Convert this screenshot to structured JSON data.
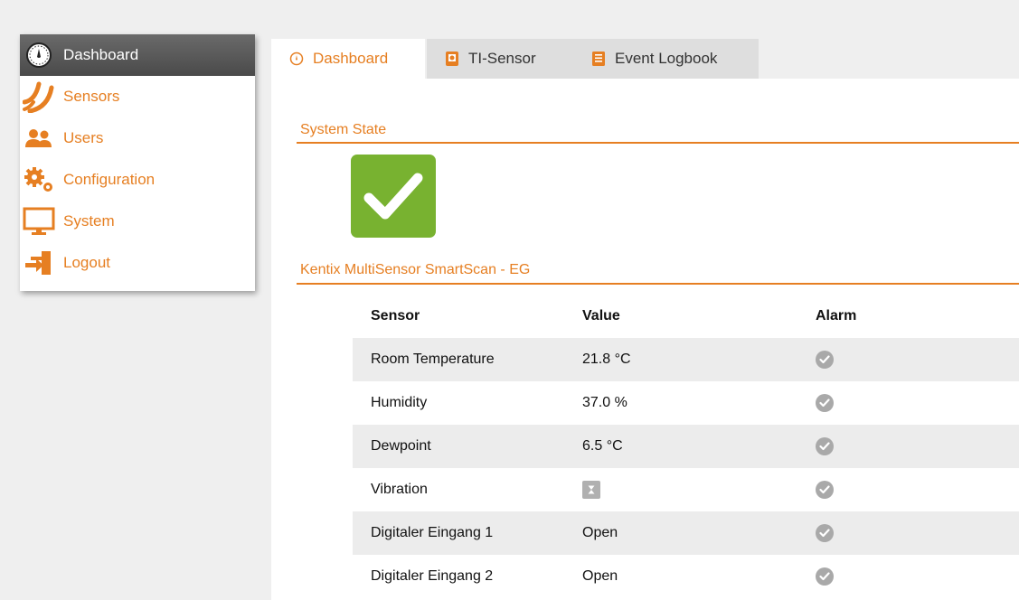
{
  "sidebar": {
    "items": [
      {
        "label": "Dashboard",
        "icon": "gauge-icon",
        "active": true
      },
      {
        "label": "Sensors",
        "icon": "signal-waves-icon",
        "active": false
      },
      {
        "label": "Users",
        "icon": "users-icon",
        "active": false
      },
      {
        "label": "Configuration",
        "icon": "gears-icon",
        "active": false
      },
      {
        "label": "System",
        "icon": "monitor-icon",
        "active": false
      },
      {
        "label": "Logout",
        "icon": "logout-icon",
        "active": false
      }
    ]
  },
  "tabs": [
    {
      "label": "Dashboard",
      "icon": "gauge-icon",
      "active": true
    },
    {
      "label": "TI-Sensor",
      "icon": "device-icon",
      "active": false
    },
    {
      "label": "Event Logbook",
      "icon": "logbook-icon",
      "active": false
    }
  ],
  "system_state": {
    "title": "System State",
    "status_icon": "checkmark-icon",
    "status_color": "#78b230"
  },
  "sensor_table": {
    "title": "Kentix MultiSensor SmartScan - EG",
    "headers": {
      "sensor": "Sensor",
      "value": "Value",
      "alarm": "Alarm"
    },
    "rows": [
      {
        "sensor": "Room Temperature",
        "value": "21.8 °C",
        "alarm_icon": "check-circle-icon"
      },
      {
        "sensor": "Humidity",
        "value": "37.0 %",
        "alarm_icon": "check-circle-icon"
      },
      {
        "sensor": "Dewpoint",
        "value": "6.5 °C",
        "alarm_icon": "check-circle-icon"
      },
      {
        "sensor": "Vibration",
        "value": "",
        "value_icon": "not-available-icon",
        "alarm_icon": "check-circle-icon"
      },
      {
        "sensor": "Digitaler Eingang 1",
        "value": "Open",
        "alarm_icon": "check-circle-icon"
      },
      {
        "sensor": "Digitaler Eingang 2",
        "value": "Open",
        "alarm_icon": "check-circle-icon"
      }
    ]
  },
  "colors": {
    "accent": "#e67f22",
    "ok_green": "#78b230",
    "sidebar_active": "#555555"
  }
}
